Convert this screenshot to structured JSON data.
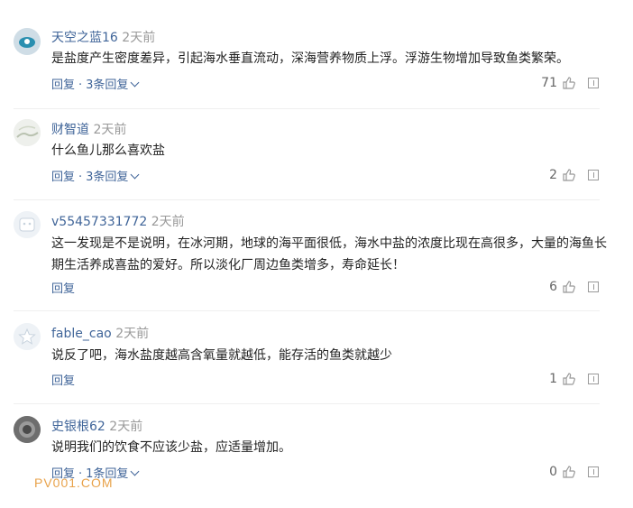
{
  "comments": [
    {
      "user": "天空之蓝16",
      "time": "2天前",
      "text": "是盐度产生密度差异，引起海水垂直流动，深海营养物质上浮。浮游生物增加导致鱼类繁荣。",
      "reply_label": "回复",
      "replies_label": "3条回复",
      "likes": "71",
      "avatar_icon": "blue-eye-avatar-icon"
    },
    {
      "user": "财智道",
      "time": "2天前",
      "text": "什么鱼儿那么喜欢盐",
      "reply_label": "回复",
      "replies_label": "3条回复",
      "likes": "2",
      "avatar_icon": "landscape-avatar-icon"
    },
    {
      "user": "v55457331772",
      "time": "2天前",
      "text": "这一发现是不是说明，在冰河期，地球的海平面很低，海水中盐的浓度比现在高很多，大量的海鱼长期生活养成喜盐的爱好。所以淡化厂周边鱼类增多，寿命延长！",
      "reply_label": "回复",
      "replies_label": "",
      "likes": "6",
      "avatar_icon": "default-user-avatar-icon"
    },
    {
      "user": "fable_cao",
      "time": "2天前",
      "text": "说反了吧，海水盐度越高含氧量就越低，能存活的鱼类就越少",
      "reply_label": "回复",
      "replies_label": "",
      "likes": "1",
      "avatar_icon": "default-star-avatar-icon"
    },
    {
      "user": "史银根62",
      "time": "2天前",
      "text": "说明我们的饮食不应该少盐，应适量增加。",
      "reply_label": "回复",
      "replies_label": "1条回复",
      "likes": "0",
      "avatar_icon": "photo-avatar-icon"
    }
  ],
  "separator": "·",
  "watermark": "PV001.COM",
  "colors": {
    "username": "#406599",
    "link": "#406599",
    "meta": "#999999",
    "watermark": "#e8a24a"
  }
}
